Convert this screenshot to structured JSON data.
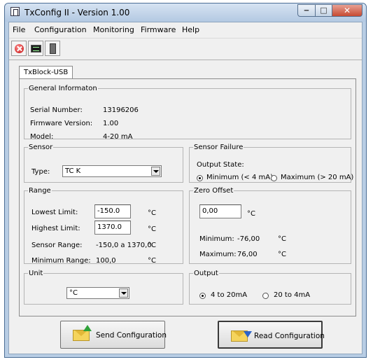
{
  "window": {
    "title": "TxConfig II - Version 1.00",
    "min_glyph": "‒",
    "max_glyph": "□",
    "close_glyph": "✕"
  },
  "menu": [
    "File",
    "Configuration",
    "Monitoring",
    "Firmware",
    "Help"
  ],
  "toolbar": {
    "icons": [
      "stop-icon",
      "monitor-icon",
      "chip-icon"
    ]
  },
  "tab": {
    "label": "TxBlock-USB"
  },
  "general": {
    "title": "General Informaton",
    "serial_label": "Serial Number:",
    "serial_value": "13196206",
    "firmware_label": "Firmware Version:",
    "firmware_value": "1.00",
    "model_label": "Model:",
    "model_value": "4-20 mA"
  },
  "sensor": {
    "title": "Sensor",
    "type_label": "Type:",
    "type_value": "TC K"
  },
  "sensor_failure": {
    "title": "Sensor Failure",
    "output_label": "Output State:",
    "option_min": "Minimum (< 4 mA)",
    "option_max": "Maximum (> 20 mA)",
    "selected": "min"
  },
  "range": {
    "title": "Range",
    "lowest_label": "Lowest Limit:",
    "lowest_value": "-150.0",
    "lowest_unit": "°C",
    "highest_label": "Highest Limit:",
    "highest_value": "1370.0",
    "highest_unit": "°C",
    "sensor_range_label": "Sensor Range:",
    "sensor_range_value": "-150,0 a 1370,0",
    "sensor_range_unit": "°C",
    "min_range_label": "Minimum Range:",
    "min_range_value": "100,0",
    "min_range_unit": "°C"
  },
  "zero_offset": {
    "title": "Zero Offset",
    "value": "0,00",
    "unit": "°C",
    "minimum_label": "Minimum:",
    "minimum_value": "-76,00",
    "minimum_unit": "°C",
    "maximum_label": "Maximum:",
    "maximum_value": "76,00",
    "maximum_unit": "°C"
  },
  "unit": {
    "title": "Unit",
    "value": "°C"
  },
  "output": {
    "title": "Output",
    "option_a": "4 to 20mA",
    "option_b": "20 to 4mA",
    "selected": "a"
  },
  "buttons": {
    "send": "Send Configuration",
    "read": "Read Configuration"
  }
}
